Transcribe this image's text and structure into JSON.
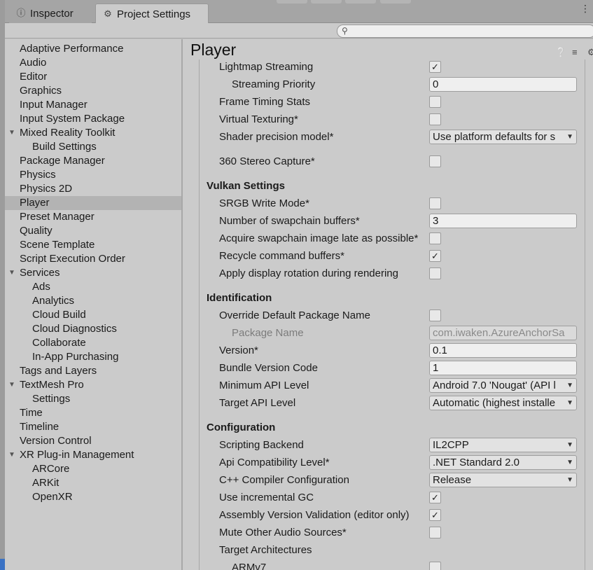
{
  "tabs": {
    "inspector": {
      "label": "Inspector",
      "icon": "info-icon"
    },
    "project_settings": {
      "label": "Project Settings",
      "icon": "gear-icon"
    }
  },
  "search": {
    "placeholder": "",
    "icon": "search-icon"
  },
  "sidebar": {
    "selected": "Player",
    "items": [
      {
        "label": "Adaptive Performance",
        "level": 0
      },
      {
        "label": "Audio",
        "level": 0
      },
      {
        "label": "Editor",
        "level": 0
      },
      {
        "label": "Graphics",
        "level": 0
      },
      {
        "label": "Input Manager",
        "level": 0
      },
      {
        "label": "Input System Package",
        "level": 0
      },
      {
        "label": "Mixed Reality Toolkit",
        "level": 0,
        "expanded": true
      },
      {
        "label": "Build Settings",
        "level": 1
      },
      {
        "label": "Package Manager",
        "level": 0
      },
      {
        "label": "Physics",
        "level": 0
      },
      {
        "label": "Physics 2D",
        "level": 0
      },
      {
        "label": "Player",
        "level": 0
      },
      {
        "label": "Preset Manager",
        "level": 0
      },
      {
        "label": "Quality",
        "level": 0
      },
      {
        "label": "Scene Template",
        "level": 0
      },
      {
        "label": "Script Execution Order",
        "level": 0
      },
      {
        "label": "Services",
        "level": 0,
        "expanded": true
      },
      {
        "label": "Ads",
        "level": 1
      },
      {
        "label": "Analytics",
        "level": 1
      },
      {
        "label": "Cloud Build",
        "level": 1
      },
      {
        "label": "Cloud Diagnostics",
        "level": 1
      },
      {
        "label": "Collaborate",
        "level": 1
      },
      {
        "label": "In-App Purchasing",
        "level": 1
      },
      {
        "label": "Tags and Layers",
        "level": 0
      },
      {
        "label": "TextMesh Pro",
        "level": 0,
        "expanded": true
      },
      {
        "label": "Settings",
        "level": 1
      },
      {
        "label": "Time",
        "level": 0
      },
      {
        "label": "Timeline",
        "level": 0
      },
      {
        "label": "Version Control",
        "level": 0
      },
      {
        "label": "XR Plug-in Management",
        "level": 0,
        "expanded": true
      },
      {
        "label": "ARCore",
        "level": 1
      },
      {
        "label": "ARKit",
        "level": 1
      },
      {
        "label": "OpenXR",
        "level": 1
      }
    ]
  },
  "main": {
    "title": "Player",
    "header_icons": [
      "help-icon",
      "presets-icon",
      "settings-icon"
    ],
    "rows": [
      {
        "label": "Lightmap Streaming",
        "type": "checkbox",
        "checked": true
      },
      {
        "label": "Streaming Priority",
        "type": "field",
        "value": "0",
        "indent": 2
      },
      {
        "label": "Frame Timing Stats",
        "type": "checkbox",
        "checked": false
      },
      {
        "label": "Virtual Texturing*",
        "type": "checkbox",
        "checked": false
      },
      {
        "label": "Shader precision model*",
        "type": "dropdown",
        "value": "Use platform defaults for s"
      },
      {
        "type": "spacer"
      },
      {
        "label": "360 Stereo Capture*",
        "type": "checkbox",
        "checked": false
      },
      {
        "type": "spacer"
      },
      {
        "label": "Vulkan Settings",
        "type": "section"
      },
      {
        "label": "SRGB Write Mode*",
        "type": "checkbox",
        "checked": false
      },
      {
        "label": "Number of swapchain buffers*",
        "type": "field",
        "value": "3"
      },
      {
        "label": "Acquire swapchain image late as possible*",
        "type": "checkbox",
        "checked": false
      },
      {
        "label": "Recycle command buffers*",
        "type": "checkbox",
        "checked": true
      },
      {
        "label": "Apply display rotation during rendering",
        "type": "checkbox",
        "checked": false
      },
      {
        "type": "spacer"
      },
      {
        "label": "Identification",
        "type": "section"
      },
      {
        "label": "Override Default Package Name",
        "type": "checkbox",
        "checked": false
      },
      {
        "label": "Package Name",
        "type": "field",
        "value": "com.iwaken.AzureAnchorSa",
        "indent": 2,
        "disabled": true
      },
      {
        "label": "Version*",
        "type": "field",
        "value": "0.1"
      },
      {
        "label": "Bundle Version Code",
        "type": "field",
        "value": "1"
      },
      {
        "label": "Minimum API Level",
        "type": "dropdown",
        "value": "Android 7.0 'Nougat' (API l"
      },
      {
        "label": "Target API Level",
        "type": "dropdown",
        "value": "Automatic (highest installe"
      },
      {
        "type": "spacer"
      },
      {
        "label": "Configuration",
        "type": "section"
      },
      {
        "label": "Scripting Backend",
        "type": "dropdown",
        "value": "IL2CPP"
      },
      {
        "label": "Api Compatibility Level*",
        "type": "dropdown",
        "value": ".NET Standard 2.0"
      },
      {
        "label": "C++ Compiler Configuration",
        "type": "dropdown",
        "value": "Release"
      },
      {
        "label": "Use incremental GC",
        "type": "checkbox",
        "checked": true
      },
      {
        "label": "Assembly Version Validation (editor only)",
        "type": "checkbox",
        "checked": true
      },
      {
        "label": "Mute Other Audio Sources*",
        "type": "checkbox",
        "checked": false
      },
      {
        "label": "Target Architectures",
        "type": "label"
      },
      {
        "label": "ARMv7",
        "type": "checkbox",
        "checked": false,
        "indent": 2
      }
    ]
  },
  "colors": {
    "selected_row": "#b3b3b3",
    "panel": "#cbcbcb",
    "tabbar": "#a5a5a5"
  }
}
